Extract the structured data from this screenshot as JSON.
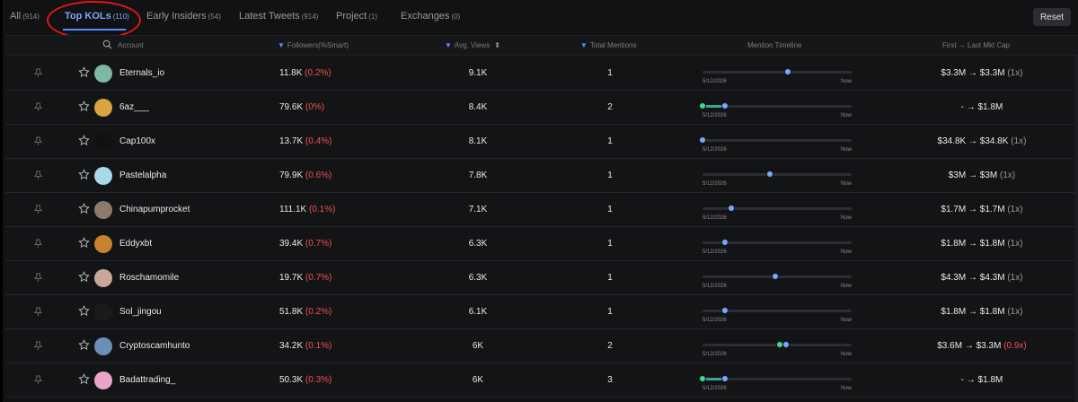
{
  "tabs": [
    {
      "label": "All",
      "count": "(914)"
    },
    {
      "label": "Top KOLs",
      "count": "(110)"
    },
    {
      "label": "Early Insiders",
      "count": "(54)"
    },
    {
      "label": "Latest Tweets",
      "count": "(914)"
    },
    {
      "label": "Project",
      "count": "(1)"
    },
    {
      "label": "Exchanges",
      "count": "(0)"
    }
  ],
  "reset_label": "Reset",
  "headers": {
    "account": "Account",
    "followers": "Followers(%Smart)",
    "avg_views": "Avg. Views",
    "total_mentions": "Total Mentions",
    "timeline": "Mention Timeline",
    "mkt_cap": "First → Last Mkt Cap"
  },
  "timeline_labels": {
    "start": "5/12/2026",
    "end": "Now"
  },
  "rows": [
    {
      "account": "Eternals_io",
      "followers": "11.8K",
      "smart": "(0.2%)",
      "views": "9.1K",
      "mentions": "1",
      "cap": "$3.3M → $3.3M",
      "mult": "(1x)",
      "mult_red": false,
      "dots": [
        {
          "pos": 0.57,
          "color": "blue"
        }
      ],
      "seg": null,
      "avatar": "#7fb8a5"
    },
    {
      "account": "6az___",
      "followers": "79.6K",
      "smart": "(0%)",
      "views": "8.4K",
      "mentions": "2",
      "cap": "- → $1.8M",
      "mult": "",
      "mult_red": false,
      "dots": [
        {
          "pos": 0.0,
          "color": "green"
        },
        {
          "pos": 0.15,
          "color": "blue"
        }
      ],
      "seg": [
        0.0,
        0.15
      ],
      "avatar": "#d9a441"
    },
    {
      "account": "Cap100x",
      "followers": "13.7K",
      "smart": "(0.4%)",
      "views": "8.1K",
      "mentions": "1",
      "cap": "$34.8K → $34.8K",
      "mult": "(1x)",
      "mult_red": false,
      "dots": [
        {
          "pos": 0.0,
          "color": "blue"
        }
      ],
      "seg": null,
      "avatar": "#111111"
    },
    {
      "account": "Pastelalpha",
      "followers": "79.9K",
      "smart": "(0.6%)",
      "views": "7.8K",
      "mentions": "1",
      "cap": "$3M → $3M",
      "mult": "(1x)",
      "mult_red": false,
      "dots": [
        {
          "pos": 0.45,
          "color": "blue"
        }
      ],
      "seg": null,
      "avatar": "#a8d8ea"
    },
    {
      "account": "Chinapumprocket",
      "followers": "111.1K",
      "smart": "(0.1%)",
      "views": "7.1K",
      "mentions": "1",
      "cap": "$1.7M → $1.7M",
      "mult": "(1x)",
      "mult_red": false,
      "dots": [
        {
          "pos": 0.19,
          "color": "blue"
        }
      ],
      "seg": null,
      "avatar": "#8c7b6a"
    },
    {
      "account": "Eddyxbt",
      "followers": "39.4K",
      "smart": "(0.7%)",
      "views": "6.3K",
      "mentions": "1",
      "cap": "$1.8M → $1.8M",
      "mult": "(1x)",
      "mult_red": false,
      "dots": [
        {
          "pos": 0.15,
          "color": "blue"
        }
      ],
      "seg": null,
      "avatar": "#c9822e"
    },
    {
      "account": "Roschamomile",
      "followers": "19.7K",
      "smart": "(0.7%)",
      "views": "6.3K",
      "mentions": "1",
      "cap": "$4.3M → $4.3M",
      "mult": "(1x)",
      "mult_red": false,
      "dots": [
        {
          "pos": 0.49,
          "color": "blue"
        }
      ],
      "seg": null,
      "avatar": "#c8a89a"
    },
    {
      "account": "Sol_jingou",
      "followers": "51.8K",
      "smart": "(0.2%)",
      "views": "6.1K",
      "mentions": "1",
      "cap": "$1.8M → $1.8M",
      "mult": "(1x)",
      "mult_red": false,
      "dots": [
        {
          "pos": 0.15,
          "color": "blue"
        }
      ],
      "seg": null,
      "avatar": "#1a1a1a"
    },
    {
      "account": "Cryptoscamhunto",
      "followers": "34.2K",
      "smart": "(0.1%)",
      "views": "6K",
      "mentions": "2",
      "cap": "$3.6M → $3.3M",
      "mult": "(0.9x)",
      "mult_red": true,
      "dots": [
        {
          "pos": 0.52,
          "color": "green"
        },
        {
          "pos": 0.56,
          "color": "blue"
        }
      ],
      "seg": [
        0.52,
        0.56
      ],
      "avatar": "#6b8fb5"
    },
    {
      "account": "Badattrading_",
      "followers": "50.3K",
      "smart": "(0.3%)",
      "views": "6K",
      "mentions": "3",
      "cap": "- → $1.8M",
      "mult": "",
      "mult_red": false,
      "dots": [
        {
          "pos": 0.0,
          "color": "green"
        },
        {
          "pos": 0.15,
          "color": "blue"
        }
      ],
      "seg": [
        0.0,
        0.15
      ],
      "avatar": "#e7a6c8"
    }
  ],
  "colors": {
    "accent": "#5b8cff",
    "negative": "#ef5350",
    "green": "#3ddc84"
  }
}
